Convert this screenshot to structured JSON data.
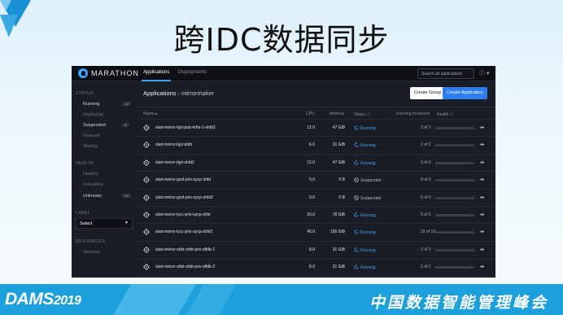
{
  "slide": {
    "title": "跨IDC数据同步",
    "footer_brand": "DAMS",
    "footer_year": "2019",
    "footer_tagline": "中国数据智能管理峰会"
  },
  "topbar": {
    "brand": "MARATHON",
    "tabs": [
      {
        "label": "Applications",
        "active": true
      },
      {
        "label": "Deployments",
        "active": false
      }
    ],
    "search_placeholder": "Search all applications",
    "help_icon": "help-circle-icon"
  },
  "sidebar": {
    "status_heading": "STATUS",
    "status_items": [
      {
        "label": "Running",
        "count": "12"
      },
      {
        "label": "Deploying",
        "count": ""
      },
      {
        "label": "Suspended",
        "count": "2"
      },
      {
        "label": "Delayed",
        "count": ""
      },
      {
        "label": "Waiting",
        "count": ""
      }
    ],
    "health_heading": "HEALTH",
    "health_items": [
      {
        "label": "Healthy",
        "count": ""
      },
      {
        "label": "Unhealthy",
        "count": ""
      },
      {
        "label": "Unknown",
        "count": "12"
      }
    ],
    "label_heading": "LABEL",
    "label_select_value": "Select",
    "resources_heading": "RESOURCES",
    "resources_items": [
      {
        "label": "Volumes"
      }
    ]
  },
  "main": {
    "breadcrumb_root": "Applications",
    "breadcrumb_leaf": "mirrormaker",
    "create_group_label": "Create Group",
    "create_app_label": "Create Application",
    "columns": [
      "Name",
      "CPU",
      "Memory",
      "Status",
      "Running Instances",
      "Health"
    ],
    "rows": [
      {
        "name": "start-mirror-bjyt-pub-infra-1-shbt2",
        "cpu": "12.0",
        "memory": "47 GiB",
        "status": "Running",
        "instances": "3 of 3"
      },
      {
        "name": "start-mirror-bjyt-sbbt",
        "cpu": "6.0",
        "memory": "31 GiB",
        "status": "Running",
        "instances": "2 of 2"
      },
      {
        "name": "start-mirror-bjyt-shbt2",
        "cpu": "12.0",
        "memory": "47 GiB",
        "status": "Running",
        "instances": "3 of 3"
      },
      {
        "name": "start-mirror-gzst-priv-sycp-shbt",
        "cpu": "0.0",
        "memory": "0 B",
        "status": "Suspended",
        "instances": "0 of 0"
      },
      {
        "name": "start-mirror-gzst-priv-sycp-shbt2",
        "cpu": "0.0",
        "memory": "0 B",
        "status": "Suspended",
        "instances": "0 of 0"
      },
      {
        "name": "start-mirror-lycc-priv-sycp-shbt",
        "cpu": "20.0",
        "memory": "78 GiB",
        "status": "Running",
        "instances": "5 of 5"
      },
      {
        "name": "start-mirror-lycc-priv-sycp-shbt2",
        "cpu": "40.0",
        "memory": "156 GiB",
        "status": "Running",
        "instances": "10 of 10"
      },
      {
        "name": "start-mirror-shbt-shbt-priv-sffdb-1",
        "cpu": "8.0",
        "memory": "31 GiB",
        "status": "Running",
        "instances": "2 of 2"
      },
      {
        "name": "start-mirror-shbt-shbt-priv-sffdb-2",
        "cpu": "8.0",
        "memory": "31 GiB",
        "status": "Running",
        "instances": "2 of 2"
      }
    ]
  },
  "colors": {
    "accent": "#3aa3ff",
    "primary_button": "#2d7cf0",
    "app_background": "#1b1d26",
    "footer": "#1ca0dc"
  }
}
